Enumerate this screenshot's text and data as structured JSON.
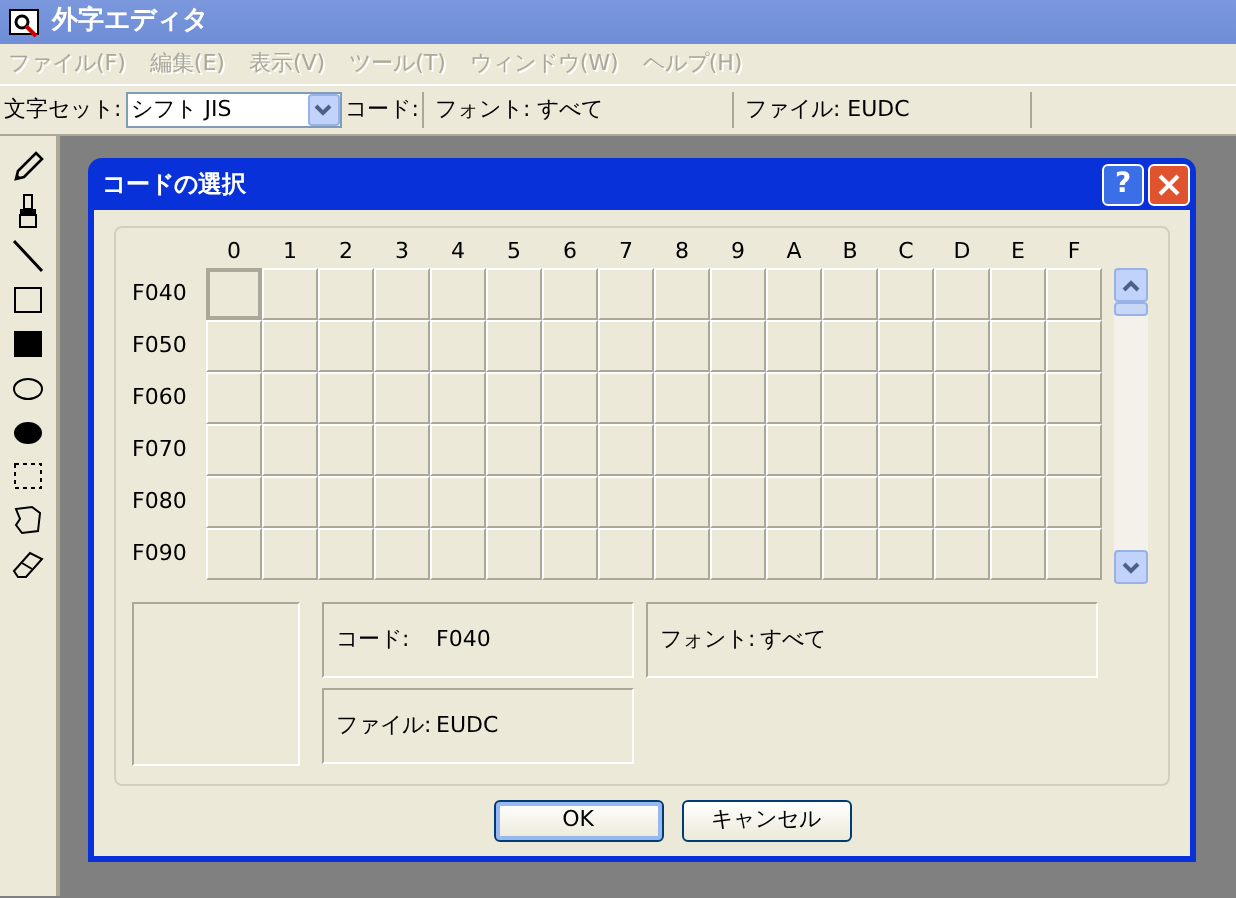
{
  "window": {
    "title": "外字エディタ"
  },
  "menu": [
    {
      "label": "ファイル(F)",
      "disabled": true
    },
    {
      "label": "編集(E)",
      "disabled": true
    },
    {
      "label": "表示(V)",
      "disabled": true
    },
    {
      "label": "ツール(T)",
      "disabled": true
    },
    {
      "label": "ウィンドウ(W)",
      "disabled": true
    },
    {
      "label": "ヘルプ(H)",
      "disabled": true
    }
  ],
  "toolbar": {
    "charset_label": "文字セット:",
    "charset_value": "シフト JIS",
    "code_label": "コード:",
    "font_status": "フォント: すべて",
    "file_status": "ファイル: EUDC"
  },
  "tools": [
    {
      "kind": "pencil"
    },
    {
      "kind": "brush"
    },
    {
      "kind": "line"
    },
    {
      "kind": "rect"
    },
    {
      "kind": "filled-rect"
    },
    {
      "kind": "ellipse"
    },
    {
      "kind": "filled-ellipse"
    },
    {
      "kind": "select-rect"
    },
    {
      "kind": "select-free"
    },
    {
      "kind": "eraser"
    }
  ],
  "dialog": {
    "title": "コードの選択",
    "help_button": "?",
    "columns": [
      {
        "label": "0",
        "selected": true
      },
      {
        "label": "1",
        "selected": false
      },
      {
        "label": "2",
        "selected": false
      },
      {
        "label": "3",
        "selected": false
      },
      {
        "label": "4",
        "selected": false
      },
      {
        "label": "5",
        "selected": false
      },
      {
        "label": "6",
        "selected": false
      },
      {
        "label": "7",
        "selected": false
      },
      {
        "label": "8",
        "selected": false
      },
      {
        "label": "9",
        "selected": false
      },
      {
        "label": "A",
        "selected": false
      },
      {
        "label": "B",
        "selected": false
      },
      {
        "label": "C",
        "selected": false
      },
      {
        "label": "D",
        "selected": false
      },
      {
        "label": "E",
        "selected": false
      },
      {
        "label": "F",
        "selected": false
      }
    ],
    "rows": [
      {
        "label": "F040",
        "selected": true
      },
      {
        "label": "F050",
        "selected": false
      },
      {
        "label": "F060",
        "selected": false
      },
      {
        "label": "F070",
        "selected": false
      },
      {
        "label": "F080",
        "selected": false
      },
      {
        "label": "F090",
        "selected": false
      }
    ],
    "code": {
      "label": "コード:",
      "value": "F040"
    },
    "font": {
      "label": "フォント:",
      "value": "すべて"
    },
    "file": {
      "label": "ファイル:",
      "value": "EUDC"
    },
    "buttons": [
      {
        "label": "OK",
        "default": true
      },
      {
        "label": "キャンセル",
        "default": false
      }
    ]
  }
}
